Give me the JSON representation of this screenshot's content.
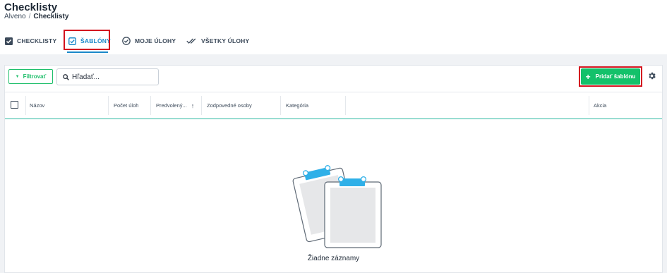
{
  "page": {
    "title": "Checklisty",
    "breadcrumb": {
      "root": "Alveno",
      "separator": "/",
      "current": "Checklisty"
    }
  },
  "tabs": [
    {
      "label": "CHECKLISTY",
      "icon": "checkbox-checked-icon",
      "active": false
    },
    {
      "label": "ŠABLÓNY",
      "icon": "template-check-icon",
      "active": true
    },
    {
      "label": "MOJE ÚLOHY",
      "icon": "circle-check-icon",
      "active": false
    },
    {
      "label": "VŠETKY ÚLOHY",
      "icon": "double-check-icon",
      "active": false
    }
  ],
  "toolbar": {
    "filter_label": "Filtrovať",
    "search_placeholder": "Hľadať...",
    "add_label": "Pridať šablónu",
    "settings_icon": "gear-icon"
  },
  "table": {
    "columns": [
      "Názov",
      "Počet úloh",
      "Predvolený...",
      "Zodpovedné osoby",
      "Kategória",
      "Akcia"
    ],
    "sorted_column": "Predvolený...",
    "sort_direction": "ascending"
  },
  "empty_state": {
    "icon": "clipboard-illustration",
    "message": "Žiadne záznamy"
  },
  "colors": {
    "accent_blue": "#1a88c9",
    "accent_green": "#13c16a",
    "highlight_red": "#d3131f",
    "clip_blue": "#2fb0e8"
  }
}
